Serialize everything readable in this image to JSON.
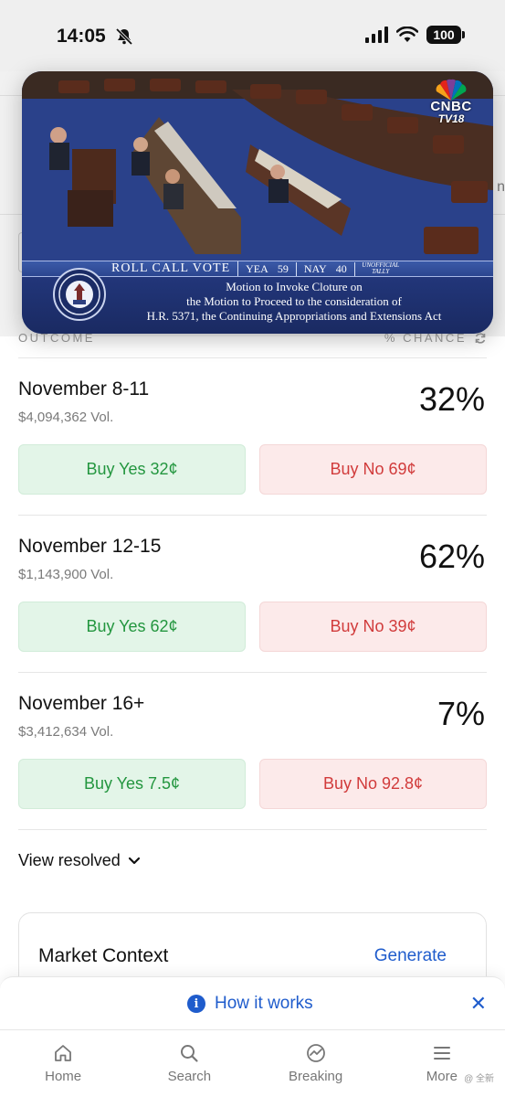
{
  "status_bar": {
    "time": "14:05",
    "battery": "100"
  },
  "page_peek": {
    "text": "n"
  },
  "video": {
    "logo_brand": "CNBC",
    "logo_sub": "TV18",
    "vote_title": "ROLL CALL VOTE",
    "yea_label": "YEA",
    "yea_value": "59",
    "nay_label": "NAY",
    "nay_value": "40",
    "tally_note": "UNOFFICIAL TALLY",
    "desc_line1": "Motion to Invoke Cloture on",
    "desc_line2": "the Motion to Proceed to the consideration of",
    "desc_line3": "H.R. 5371, the Continuing Appropriations and Extensions Act"
  },
  "table_header": {
    "outcome": "OUTCOME",
    "chance": "% CHANCE"
  },
  "markets": [
    {
      "title": "November 8-11",
      "volume": "$4,094,362 Vol.",
      "chance": "32%",
      "yes": "Buy Yes 32¢",
      "no": "Buy No 69¢"
    },
    {
      "title": "November 12-15",
      "volume": "$1,143,900 Vol.",
      "chance": "62%",
      "yes": "Buy Yes 62¢",
      "no": "Buy No 39¢"
    },
    {
      "title": "November 16+",
      "volume": "$3,412,634 Vol.",
      "chance": "7%",
      "yes": "Buy Yes 7.5¢",
      "no": "Buy No 92.8¢"
    }
  ],
  "view_resolved": "View resolved",
  "market_context": {
    "title": "Market Context",
    "action": "Generate"
  },
  "how_it_works": {
    "label": "How it works",
    "close": "✕"
  },
  "tabs": [
    {
      "label": "Home",
      "icon": "home-icon"
    },
    {
      "label": "Search",
      "icon": "search-icon"
    },
    {
      "label": "Breaking",
      "icon": "breaking-icon"
    },
    {
      "label": "More",
      "icon": "menu-icon"
    }
  ],
  "watermark": "@ 全新"
}
